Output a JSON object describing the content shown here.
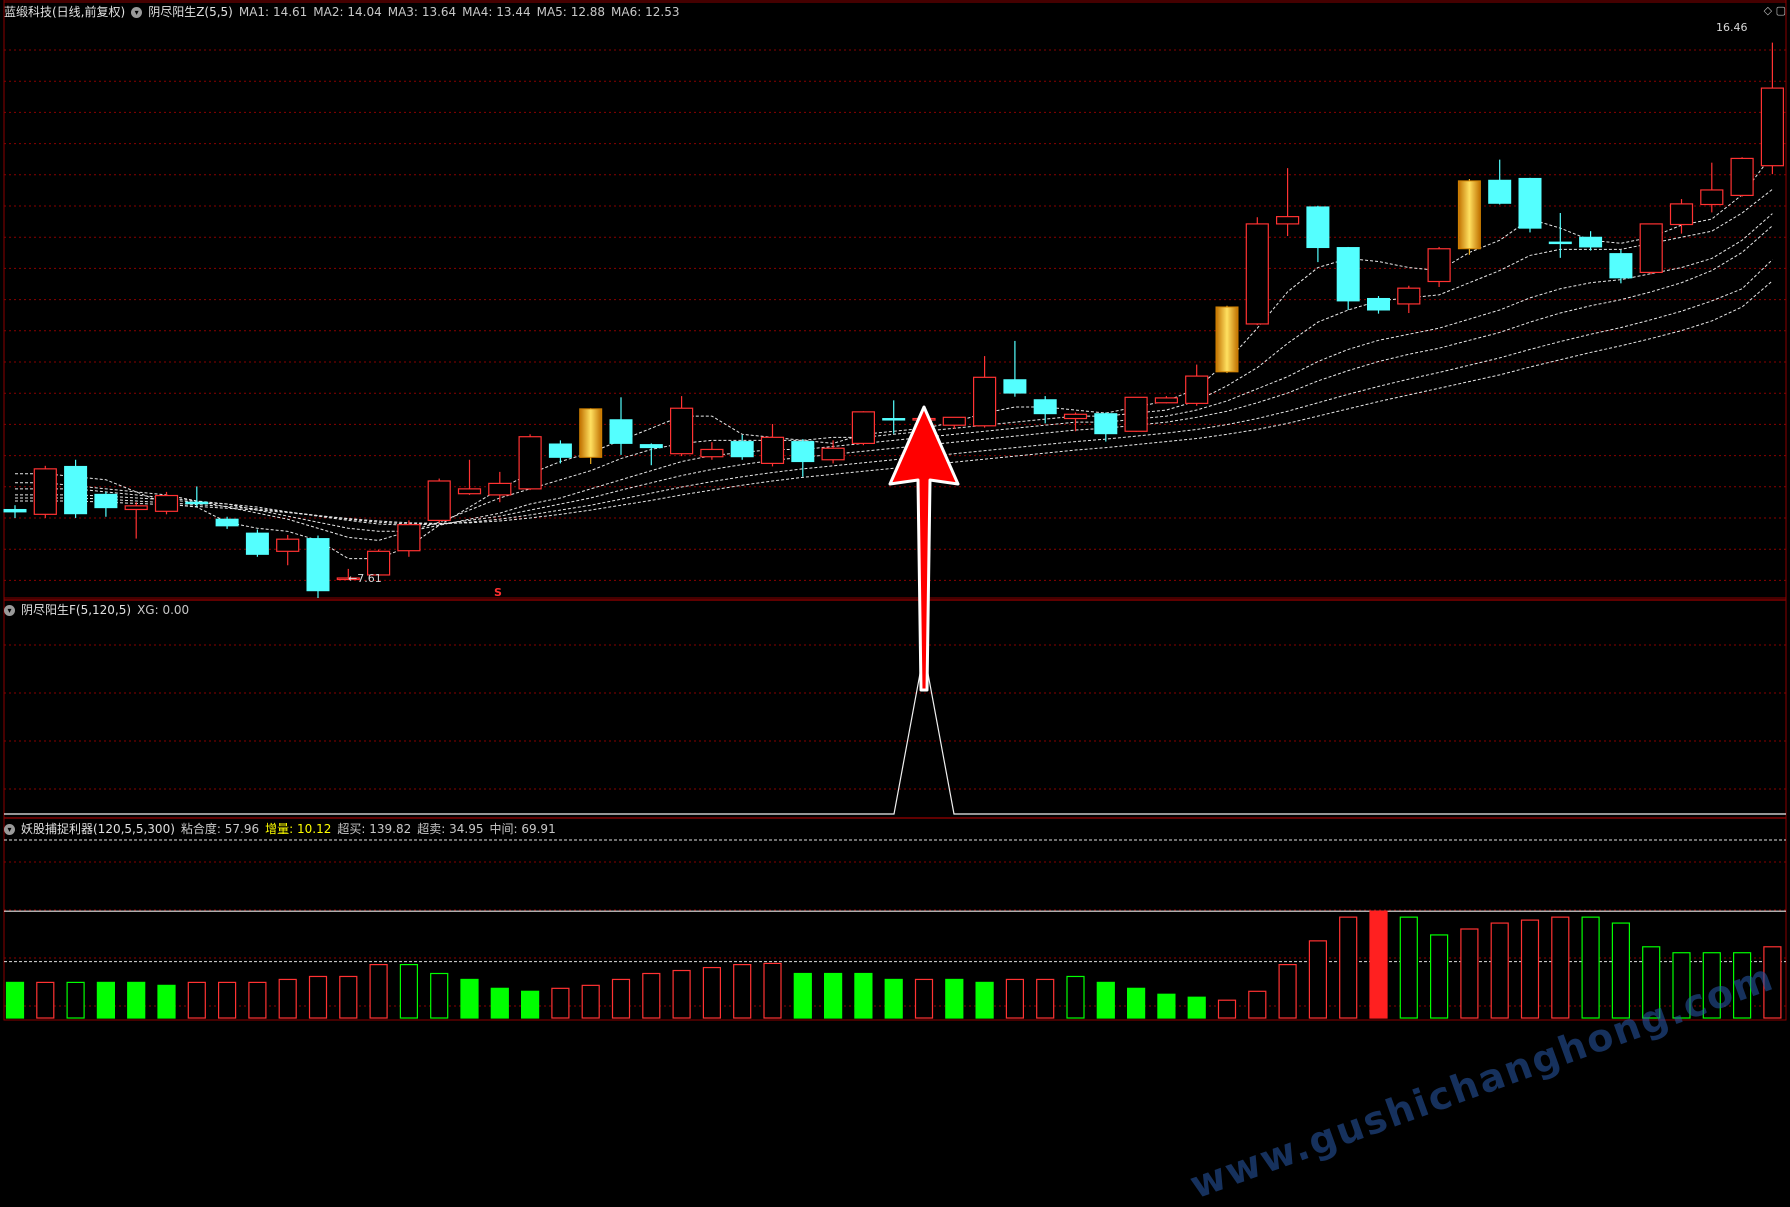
{
  "main_panel": {
    "stock": "蓝缎科技(日线,前复权)",
    "indicator": "阴尽阳生Z(5,5)",
    "ma": [
      {
        "label": "MA1:",
        "value": "14.61"
      },
      {
        "label": "MA2:",
        "value": "14.04"
      },
      {
        "label": "MA3:",
        "value": "13.64"
      },
      {
        "label": "MA4:",
        "value": "13.44"
      },
      {
        "label": "MA5:",
        "value": "12.88"
      },
      {
        "label": "MA6:",
        "value": "12.53"
      }
    ],
    "high_label": "16.46",
    "low_label": "7.61",
    "signal_label": "S"
  },
  "panel2": {
    "indicator": "阴尽阳生F(5,120,5)",
    "xg_label": "XG:",
    "xg_value": "0.00"
  },
  "panel3": {
    "indicator": "妖股捕捉利器(120,5,5,300)",
    "fields": [
      {
        "label": "粘合度:",
        "value": "57.96",
        "color": "normal"
      },
      {
        "label": "增量:",
        "value": "10.12",
        "color": "yellow"
      },
      {
        "label": "超买:",
        "value": "139.82",
        "color": "normal"
      },
      {
        "label": "超卖:",
        "value": "34.95",
        "color": "normal"
      },
      {
        "label": "中间:",
        "value": "69.91",
        "color": "normal"
      }
    ]
  },
  "watermark": "www.gushichanghong.com",
  "colors": {
    "up": "#ff3232",
    "down": "#54ffff",
    "gold": "#f0b020",
    "grid": "#8a0000",
    "green": "#00ff00"
  },
  "chart_data": {
    "type": "candlestick",
    "price_range": [
      7.3,
      16.8
    ],
    "candles": [
      [
        8.76,
        8.72,
        8.83,
        8.62
      ],
      [
        8.68,
        9.43,
        9.48,
        8.62
      ],
      [
        9.47,
        8.69,
        9.58,
        8.62
      ],
      [
        9.01,
        8.79,
        9.05,
        8.64
      ],
      [
        8.76,
        8.82,
        8.88,
        8.28
      ],
      [
        8.73,
        8.99,
        9.05,
        8.68
      ],
      [
        8.88,
        8.86,
        9.14,
        8.81
      ],
      [
        8.6,
        8.49,
        8.64,
        8.44
      ],
      [
        8.37,
        8.02,
        8.43,
        7.98
      ],
      [
        8.07,
        8.27,
        8.34,
        7.84
      ],
      [
        8.28,
        7.42,
        8.33,
        7.3
      ],
      [
        7.62,
        7.63,
        7.78,
        7.61
      ],
      [
        7.68,
        8.07,
        8.1,
        7.66
      ],
      [
        8.08,
        8.51,
        8.58,
        7.98
      ],
      [
        8.58,
        9.23,
        9.27,
        8.54
      ],
      [
        9.02,
        9.1,
        9.58,
        9.0
      ],
      [
        9.0,
        9.19,
        9.38,
        8.88
      ],
      [
        9.1,
        9.96,
        10.0,
        9.08
      ],
      [
        9.84,
        9.62,
        9.9,
        9.52
      ],
      [
        9.62,
        10.42,
        10.43,
        9.51
      ],
      [
        10.24,
        9.85,
        10.61,
        9.66
      ],
      [
        9.83,
        9.78,
        9.85,
        9.49
      ],
      [
        9.68,
        10.43,
        10.63,
        9.64
      ],
      [
        9.63,
        9.75,
        9.87,
        9.58
      ],
      [
        9.88,
        9.63,
        9.99,
        9.58
      ],
      [
        9.52,
        9.95,
        10.17,
        9.47
      ],
      [
        9.88,
        9.55,
        9.92,
        9.3
      ],
      [
        9.58,
        9.77,
        9.9,
        9.52
      ],
      [
        9.85,
        10.37,
        10.38,
        9.82
      ],
      [
        10.26,
        10.24,
        10.56,
        10.01
      ],
      [
        10.26,
        10.26,
        10.28,
        10.05
      ],
      [
        10.15,
        10.28,
        10.28,
        10.09
      ],
      [
        10.14,
        10.94,
        11.29,
        10.11
      ],
      [
        10.9,
        10.68,
        11.54,
        10.62
      ],
      [
        10.57,
        10.34,
        10.63,
        10.18
      ],
      [
        10.26,
        10.33,
        10.36,
        10.05
      ],
      [
        10.34,
        10.01,
        10.36,
        9.88
      ],
      [
        10.05,
        10.61,
        10.61,
        10.04
      ],
      [
        10.52,
        10.6,
        10.63,
        10.51
      ],
      [
        10.51,
        10.96,
        11.15,
        10.47
      ],
      [
        11.03,
        12.1,
        12.12,
        11.01
      ],
      [
        11.82,
        13.47,
        13.58,
        11.8
      ],
      [
        13.47,
        13.59,
        14.39,
        13.27
      ],
      [
        13.75,
        13.08,
        13.77,
        12.84
      ],
      [
        13.08,
        12.2,
        13.09,
        12.05
      ],
      [
        12.24,
        12.05,
        12.28,
        11.99
      ],
      [
        12.15,
        12.41,
        12.45,
        12.0
      ],
      [
        12.52,
        13.06,
        13.09,
        12.43
      ],
      [
        13.06,
        14.18,
        14.21,
        12.96
      ],
      [
        14.19,
        13.81,
        14.53,
        13.79
      ],
      [
        14.22,
        13.4,
        14.23,
        13.33
      ],
      [
        13.17,
        13.16,
        13.65,
        12.91
      ],
      [
        13.25,
        13.09,
        13.35,
        13.03
      ],
      [
        12.98,
        12.58,
        13.04,
        12.49
      ],
      [
        12.67,
        13.47,
        13.47,
        12.64
      ],
      [
        13.46,
        13.8,
        13.88,
        13.31
      ],
      [
        13.79,
        14.03,
        14.48,
        13.66
      ],
      [
        13.94,
        14.55,
        14.57,
        13.92
      ],
      [
        14.43,
        15.71,
        16.46,
        14.29
      ]
    ],
    "gold_candles": [
      19,
      40,
      48
    ],
    "ma_lines": [
      {
        "name": "MA1",
        "values": [
          9.35,
          9.35,
          9.3,
          9.25,
          9.05,
          8.85,
          8.8,
          8.55,
          8.45,
          8.4,
          8.25,
          7.95,
          7.95,
          8.15,
          8.5,
          8.8,
          9.1,
          9.35,
          9.55,
          9.7,
          9.9,
          10.1,
          10.3,
          10.3,
          10.0,
          9.95,
          9.9,
          9.85,
          10.0,
          10.05,
          10.1,
          10.2,
          10.35,
          10.45,
          10.45,
          10.4,
          10.35,
          10.45,
          10.55,
          10.75,
          11.2,
          11.75,
          12.35,
          12.75,
          12.9,
          12.85,
          12.75,
          12.7,
          13.0,
          13.2,
          13.55,
          13.4,
          13.2,
          13.15,
          13.25,
          13.45,
          13.55,
          13.95,
          14.61
        ]
      },
      {
        "name": "MA2",
        "values": [
          9.2,
          9.2,
          9.15,
          9.1,
          9.05,
          9.0,
          8.9,
          8.8,
          8.7,
          8.6,
          8.45,
          8.3,
          8.25,
          8.4,
          8.55,
          8.75,
          8.95,
          9.1,
          9.25,
          9.4,
          9.6,
          9.75,
          9.85,
          9.9,
          9.9,
          9.9,
          9.9,
          9.95,
          9.95,
          10.0,
          10.05,
          10.1,
          10.15,
          10.2,
          10.25,
          10.3,
          10.3,
          10.35,
          10.4,
          10.55,
          10.8,
          11.1,
          11.5,
          11.85,
          12.05,
          12.2,
          12.25,
          12.3,
          12.5,
          12.7,
          12.95,
          13.05,
          13.05,
          13.05,
          13.15,
          13.25,
          13.35,
          13.65,
          14.04
        ]
      },
      {
        "name": "MA3",
        "values": [
          9.1,
          9.1,
          9.1,
          9.05,
          9.0,
          8.95,
          8.9,
          8.85,
          8.75,
          8.65,
          8.55,
          8.45,
          8.4,
          8.4,
          8.5,
          8.6,
          8.7,
          8.85,
          8.95,
          9.1,
          9.25,
          9.4,
          9.55,
          9.65,
          9.7,
          9.75,
          9.75,
          9.8,
          9.85,
          9.9,
          9.95,
          10.0,
          10.05,
          10.1,
          10.15,
          10.2,
          10.2,
          10.25,
          10.3,
          10.4,
          10.55,
          10.75,
          10.95,
          11.2,
          11.4,
          11.55,
          11.65,
          11.75,
          11.9,
          12.05,
          12.25,
          12.4,
          12.5,
          12.55,
          12.65,
          12.75,
          12.9,
          13.2,
          13.64
        ]
      },
      {
        "name": "MA4",
        "values": [
          9.0,
          9.0,
          9.0,
          8.98,
          8.95,
          8.92,
          8.88,
          8.85,
          8.8,
          8.72,
          8.65,
          8.58,
          8.52,
          8.5,
          8.52,
          8.58,
          8.65,
          8.75,
          8.85,
          8.95,
          9.08,
          9.2,
          9.32,
          9.42,
          9.5,
          9.57,
          9.62,
          9.67,
          9.72,
          9.77,
          9.82,
          9.87,
          9.92,
          9.97,
          10.02,
          10.07,
          10.1,
          10.15,
          10.2,
          10.28,
          10.38,
          10.52,
          10.68,
          10.88,
          11.05,
          11.2,
          11.32,
          11.42,
          11.55,
          11.68,
          11.85,
          12.0,
          12.12,
          12.22,
          12.35,
          12.5,
          12.7,
          13.0,
          13.44
        ]
      },
      {
        "name": "MA5",
        "values": [
          8.95,
          8.95,
          8.95,
          8.93,
          8.9,
          8.87,
          8.84,
          8.81,
          8.77,
          8.72,
          8.66,
          8.6,
          8.55,
          8.52,
          8.52,
          8.55,
          8.6,
          8.67,
          8.75,
          8.83,
          8.93,
          9.03,
          9.13,
          9.22,
          9.3,
          9.37,
          9.43,
          9.48,
          9.53,
          9.58,
          9.63,
          9.68,
          9.73,
          9.78,
          9.83,
          9.88,
          9.92,
          9.97,
          10.02,
          10.08,
          10.16,
          10.26,
          10.38,
          10.52,
          10.66,
          10.79,
          10.91,
          11.02,
          11.14,
          11.26,
          11.4,
          11.53,
          11.65,
          11.76,
          11.89,
          12.03,
          12.2,
          12.4,
          12.88
        ]
      },
      {
        "name": "MA6",
        "values": [
          8.9,
          8.9,
          8.9,
          8.88,
          8.86,
          8.84,
          8.81,
          8.78,
          8.75,
          8.71,
          8.66,
          8.61,
          8.57,
          8.54,
          8.53,
          8.54,
          8.57,
          8.62,
          8.68,
          8.75,
          8.83,
          8.91,
          9.0,
          9.08,
          9.16,
          9.23,
          9.29,
          9.34,
          9.39,
          9.44,
          9.49,
          9.54,
          9.59,
          9.64,
          9.69,
          9.74,
          9.78,
          9.83,
          9.88,
          9.93,
          10.0,
          10.08,
          10.18,
          10.3,
          10.42,
          10.54,
          10.65,
          10.76,
          10.87,
          10.98,
          11.11,
          11.23,
          11.35,
          11.46,
          11.58,
          11.71,
          11.87,
          12.1,
          12.53
        ]
      }
    ],
    "xg_series": {
      "spike_index": 30,
      "spike_value": 1,
      "range": [
        0,
        1.2
      ]
    },
    "bars": [
      {
        "value": 6,
        "color": "green"
      },
      {
        "value": 6,
        "color": "red"
      },
      {
        "value": 6,
        "color": "green-hollow"
      },
      {
        "value": 6,
        "color": "green"
      },
      {
        "value": 6,
        "color": "green"
      },
      {
        "value": 5.5,
        "color": "green"
      },
      {
        "value": 6,
        "color": "red"
      },
      {
        "value": 6,
        "color": "red"
      },
      {
        "value": 6,
        "color": "red"
      },
      {
        "value": 6.5,
        "color": "red"
      },
      {
        "value": 7,
        "color": "red"
      },
      {
        "value": 7,
        "color": "red"
      },
      {
        "value": 9,
        "color": "red"
      },
      {
        "value": 9,
        "color": "green-hollow"
      },
      {
        "value": 7.5,
        "color": "green-hollow"
      },
      {
        "value": 6.5,
        "color": "green"
      },
      {
        "value": 5,
        "color": "green"
      },
      {
        "value": 4.5,
        "color": "green"
      },
      {
        "value": 5,
        "color": "red"
      },
      {
        "value": 5.5,
        "color": "red"
      },
      {
        "value": 6.5,
        "color": "red"
      },
      {
        "value": 7.5,
        "color": "red"
      },
      {
        "value": 8,
        "color": "red"
      },
      {
        "value": 8.5,
        "color": "red"
      },
      {
        "value": 9,
        "color": "red"
      },
      {
        "value": 9.2,
        "color": "red"
      },
      {
        "value": 7.5,
        "color": "green"
      },
      {
        "value": 7.5,
        "color": "green"
      },
      {
        "value": 7.5,
        "color": "green"
      },
      {
        "value": 6.5,
        "color": "green"
      },
      {
        "value": 6.5,
        "color": "red"
      },
      {
        "value": 6.5,
        "color": "green"
      },
      {
        "value": 6,
        "color": "green"
      },
      {
        "value": 6.5,
        "color": "red"
      },
      {
        "value": 6.5,
        "color": "red"
      },
      {
        "value": 7,
        "color": "green-hollow"
      },
      {
        "value": 6,
        "color": "green"
      },
      {
        "value": 5,
        "color": "green"
      },
      {
        "value": 4,
        "color": "green"
      },
      {
        "value": 3.5,
        "color": "green"
      },
      {
        "value": 3,
        "color": "red"
      },
      {
        "value": 4.5,
        "color": "red"
      },
      {
        "value": 9,
        "color": "red"
      },
      {
        "value": 13,
        "color": "red"
      },
      {
        "value": 17,
        "color": "red"
      },
      {
        "value": 18,
        "color": "red-fill"
      },
      {
        "value": 17,
        "color": "green-hollow"
      },
      {
        "value": 14,
        "color": "green-hollow"
      },
      {
        "value": 15,
        "color": "red"
      },
      {
        "value": 16,
        "color": "red"
      },
      {
        "value": 16.5,
        "color": "red"
      },
      {
        "value": 17,
        "color": "red"
      },
      {
        "value": 17,
        "color": "green-hollow"
      },
      {
        "value": 16,
        "color": "green-hollow"
      },
      {
        "value": 12,
        "color": "green-hollow"
      },
      {
        "value": 11,
        "color": "green-hollow"
      },
      {
        "value": 11,
        "color": "green-hollow"
      },
      {
        "value": 11,
        "color": "green-hollow"
      },
      {
        "value": 12,
        "color": "red"
      },
      {
        "value": 14.5,
        "color": "red"
      }
    ],
    "bar_range": [
      0,
      30
    ],
    "ref_lines": {
      "upper": 30,
      "middle": 18,
      "lower": 9.5
    }
  }
}
